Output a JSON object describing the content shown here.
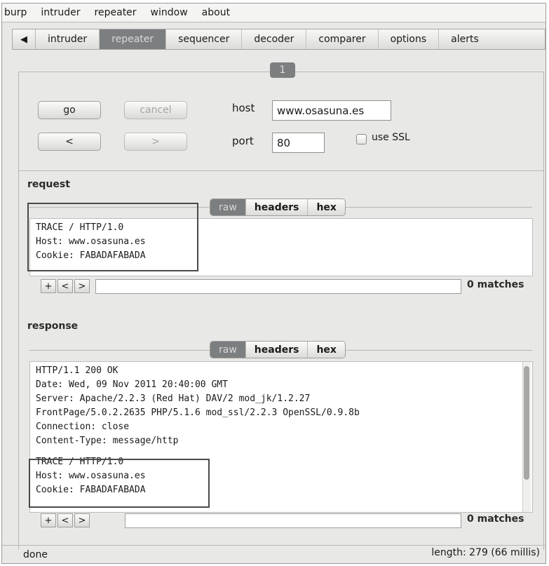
{
  "menu": [
    "burp",
    "intruder",
    "repeater",
    "window",
    "about"
  ],
  "tabs": {
    "back_arrow": "◀",
    "items": [
      "intruder",
      "repeater",
      "sequencer",
      "decoder",
      "comparer",
      "options",
      "alerts"
    ]
  },
  "subtab": "1",
  "controls": {
    "go": "go",
    "cancel": "cancel",
    "prev": "<",
    "next": ">",
    "host_label": "host",
    "host_value": "www.osasuna.es",
    "port_label": "port",
    "port_value": "80",
    "ssl_label": "use SSL"
  },
  "request": {
    "title": "request",
    "views": [
      "raw",
      "headers",
      "hex"
    ],
    "lines": [
      "TRACE / HTTP/1.0",
      "Host: www.osasuna.es",
      "Cookie: FABADAFABADA"
    ],
    "matches": "0 matches"
  },
  "response": {
    "title": "response",
    "views": [
      "raw",
      "headers",
      "hex"
    ],
    "lines": [
      "HTTP/1.1 200 OK",
      "Date: Wed, 09 Nov 2011 20:40:00 GMT",
      "Server: Apache/2.2.3 (Red Hat) DAV/2 mod_jk/1.2.27",
      "FrontPage/5.0.2.2635 PHP/5.1.6 mod_ssl/2.2.3 OpenSSL/0.9.8b",
      "Connection: close",
      "Content-Type: message/http",
      "",
      "TRACE / HTTP/1.0",
      "Host: www.osasuna.es",
      "Cookie: FABADAFABADA"
    ],
    "matches": "0 matches"
  },
  "search": {
    "plus": "+",
    "prev": "<",
    "next": ">"
  },
  "status": {
    "left": "done",
    "right": "length: 279 (66 millis)"
  }
}
